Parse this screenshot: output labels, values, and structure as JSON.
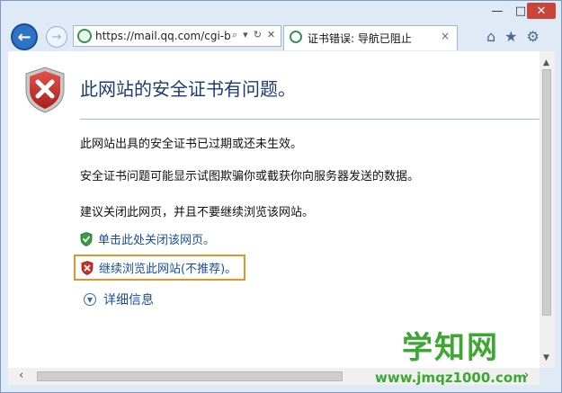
{
  "browser": {
    "url": "https://mail.qq.com/cgi-bi",
    "tab_title": "证书错误: 导航已阻止",
    "tab_close": "×",
    "window_buttons": {
      "minimize": "—",
      "maximize": "□",
      "close": "✕"
    }
  },
  "page": {
    "title": "此网站的安全证书有问题。",
    "line1": "此网站出具的安全证书已过期或还未生效。",
    "line2": "安全证书问题可能显示试图欺骗你或截获你向服务器发送的数据。",
    "line3": "建议关闭此网页，并且不要继续浏览该网站。",
    "close_link": "单击此处关闭该网页。",
    "continue_link": "继续浏览此网站(不推荐)。",
    "details": "详细信息"
  },
  "watermark": {
    "title": "学知网",
    "url": "www.jmqz1000.com"
  },
  "colors": {
    "accent_link": "#1a4d9e",
    "highlight_border": "#e0952a",
    "watermark": "#3aa831"
  },
  "icons": {
    "back": "arrow-left-icon",
    "forward": "arrow-right-icon",
    "refresh": "refresh-icon",
    "search": "search-icon",
    "home": "home-icon",
    "favorites": "star-icon",
    "tools": "gear-icon"
  }
}
